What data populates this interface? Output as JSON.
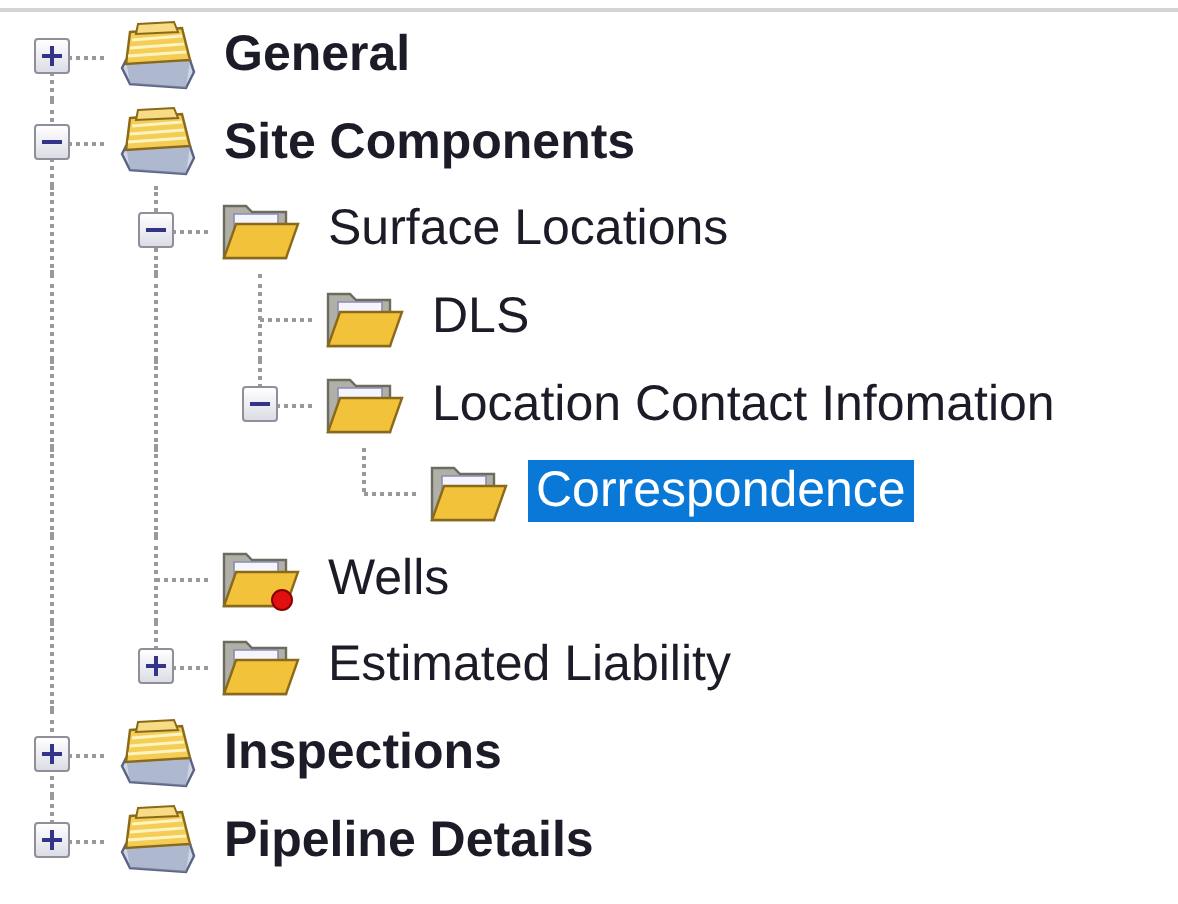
{
  "tree": [
    {
      "label": "General",
      "kind": "cabinet",
      "expanded": false,
      "selected": false
    },
    {
      "label": "Site Components",
      "kind": "cabinet",
      "expanded": true,
      "selected": false,
      "children": [
        {
          "label": "Surface Locations",
          "kind": "folder",
          "expanded": true,
          "selected": false,
          "warning": false,
          "children": [
            {
              "label": "DLS",
              "kind": "folder",
              "selected": false,
              "warning": false
            },
            {
              "label": "Location Contact Infomation",
              "kind": "folder",
              "expanded": true,
              "selected": false,
              "warning": false,
              "children": [
                {
                  "label": "Correspondence",
                  "kind": "folder",
                  "selected": true,
                  "warning": false
                }
              ]
            }
          ]
        },
        {
          "label": "Wells",
          "kind": "folder",
          "selected": false,
          "warning": true
        },
        {
          "label": "Estimated Liability",
          "kind": "folder",
          "expanded": false,
          "selected": false,
          "warning": false
        }
      ]
    },
    {
      "label": "Inspections",
      "kind": "cabinet",
      "expanded": false,
      "selected": false
    },
    {
      "label": "Pipeline Details",
      "kind": "cabinet",
      "expanded": false,
      "selected": false
    }
  ]
}
